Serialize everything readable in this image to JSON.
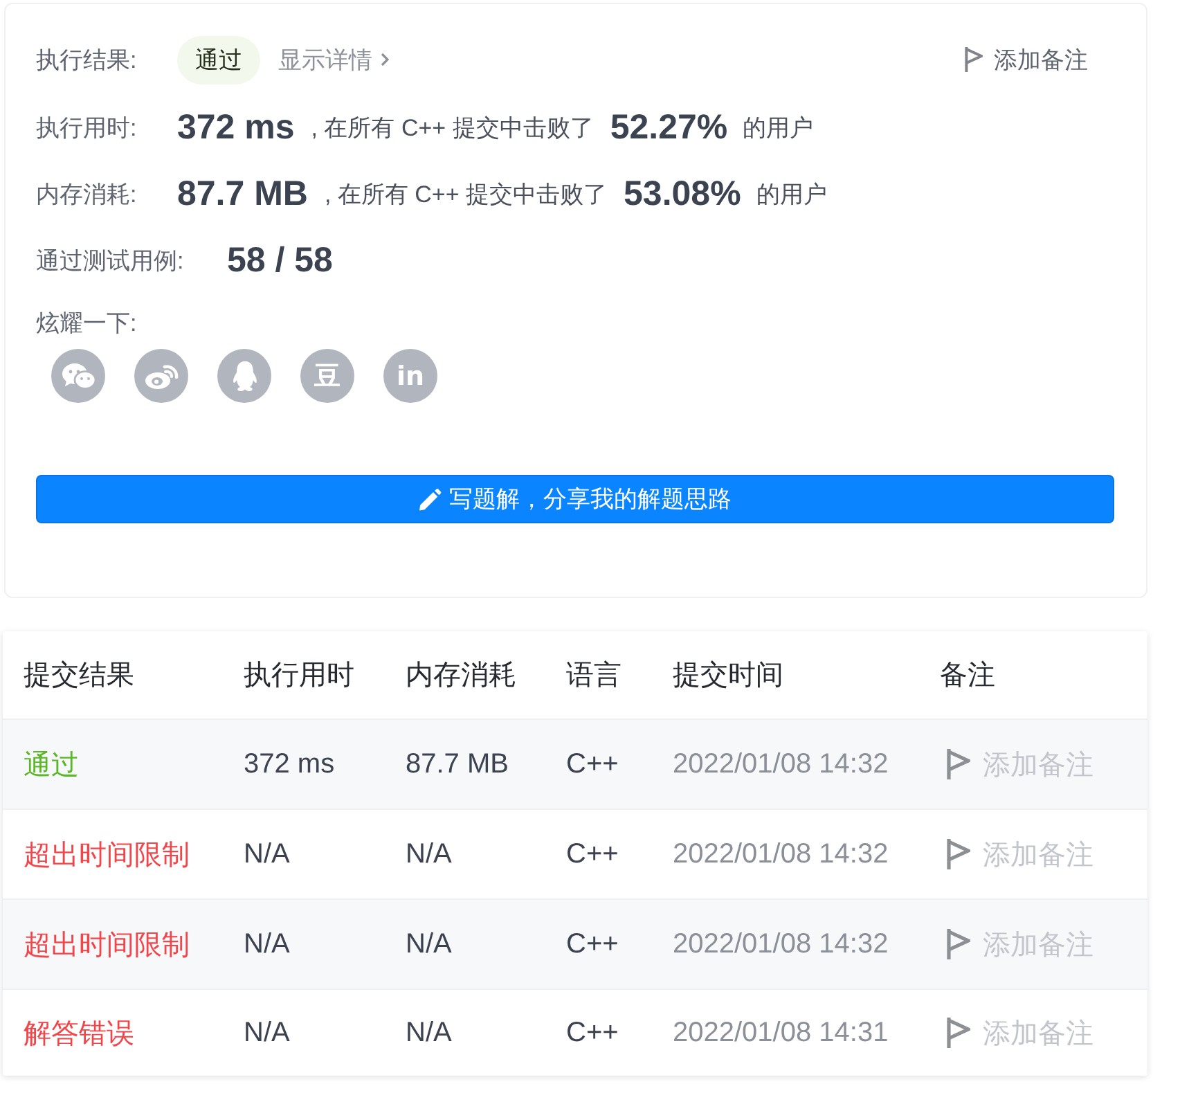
{
  "summary": {
    "result": {
      "label": "执行结果:",
      "status": "通过",
      "details_link": "显示详情"
    },
    "add_note": "添加备注",
    "stats": [
      {
        "label": "执行用时:",
        "value": "372 ms",
        "comparison": ", 在所有 C++ 提交中击败了",
        "percent": "52.27%",
        "suffix": "的用户"
      },
      {
        "label": "内存消耗:",
        "value": "87.7 MB",
        "comparison": ", 在所有 C++ 提交中击败了",
        "percent": "53.08%",
        "suffix": "的用户"
      }
    ],
    "test_cases": {
      "label": "通过测试用例:",
      "value": "58 / 58"
    },
    "share": {
      "label": "炫耀一下:",
      "buttons": [
        {
          "kind": "chat"
        },
        {
          "kind": "swirl"
        },
        {
          "kind": "penguin"
        },
        {
          "kind": "glyph",
          "glyph": "豆"
        },
        {
          "kind": "glyph",
          "glyph": "in"
        }
      ]
    },
    "solution_button": "写题解，分享我的解题思路"
  },
  "submissions": {
    "columns": [
      "提交结果",
      "执行用时",
      "内存消耗",
      "语言",
      "提交时间",
      "备注"
    ],
    "rows": [
      {
        "status": "通过",
        "color": "#5ab726",
        "runtime": "372 ms",
        "memory": "87.7 MB",
        "language": "C++",
        "time": "2022/01/08 14:32",
        "note": "添加备注"
      },
      {
        "status": "超出时间限制",
        "color": "#f2454a",
        "runtime": "N/A",
        "memory": "N/A",
        "language": "C++",
        "time": "2022/01/08 14:32",
        "note": "添加备注"
      },
      {
        "status": "超出时间限制",
        "color": "#f2454a",
        "runtime": "N/A",
        "memory": "N/A",
        "language": "C++",
        "time": "2022/01/08 14:32",
        "note": "添加备注"
      },
      {
        "status": "解答错误",
        "color": "#f2454a",
        "runtime": "N/A",
        "memory": "N/A",
        "language": "C++",
        "time": "2022/01/08 14:31",
        "note": "添加备注"
      }
    ]
  }
}
